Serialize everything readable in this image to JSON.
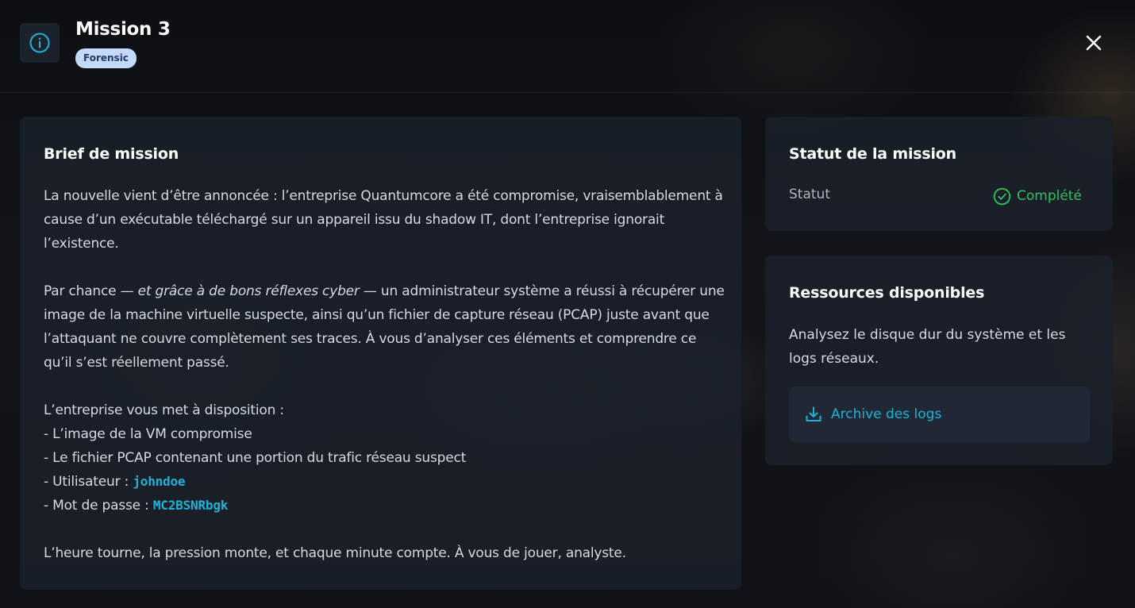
{
  "header": {
    "title": "Mission 3",
    "tag": "Forensic",
    "info_icon": "info-icon",
    "close_icon": "close-icon"
  },
  "brief": {
    "title": "Brief de mission",
    "p1": "La nouvelle vient d’être annoncée : l’entreprise Quantumcore a été compromise, vraisemblablement à cause d’un exécutable téléchargé sur un appareil issu du shadow IT, dont l’entreprise ignorait l’existence.",
    "p2_before": "Par chance — ",
    "p2_italic": "et grâce à de bons réflexes cyber",
    "p2_after": " — un administrateur système a réussi à récupérer une image de la machine virtuelle suspecte, ainsi qu’un fichier de capture réseau (PCAP) juste avant que l’attaquant ne couvre complètement ses traces. À vous d’analyser ces éléments et comprendre ce qu’il s’est réellement passé.",
    "list_intro": "L’entreprise vous met à disposition :",
    "list_items": [
      "- L’image de la VM compromise",
      "- Le fichier PCAP contenant une portion du trafic réseau suspect"
    ],
    "user_label": "- Utilisateur : ",
    "user_value": "johndoe",
    "password_label": "- Mot de passe : ",
    "password_value": "MC2BSNRbgk",
    "closing": "L’heure tourne, la pression monte, et chaque minute compte. À vous de jouer, analyste."
  },
  "status": {
    "title": "Statut de la mission",
    "label": "Statut",
    "value": "Complété",
    "icon": "check-circle-icon",
    "color": "#2fc161"
  },
  "resources": {
    "title": "Ressources disponibles",
    "description": "Analysez le disque dur du système et les logs réseaux.",
    "download_label": "Archive des logs",
    "download_icon": "download-icon",
    "accent": "#1fb2d8"
  }
}
